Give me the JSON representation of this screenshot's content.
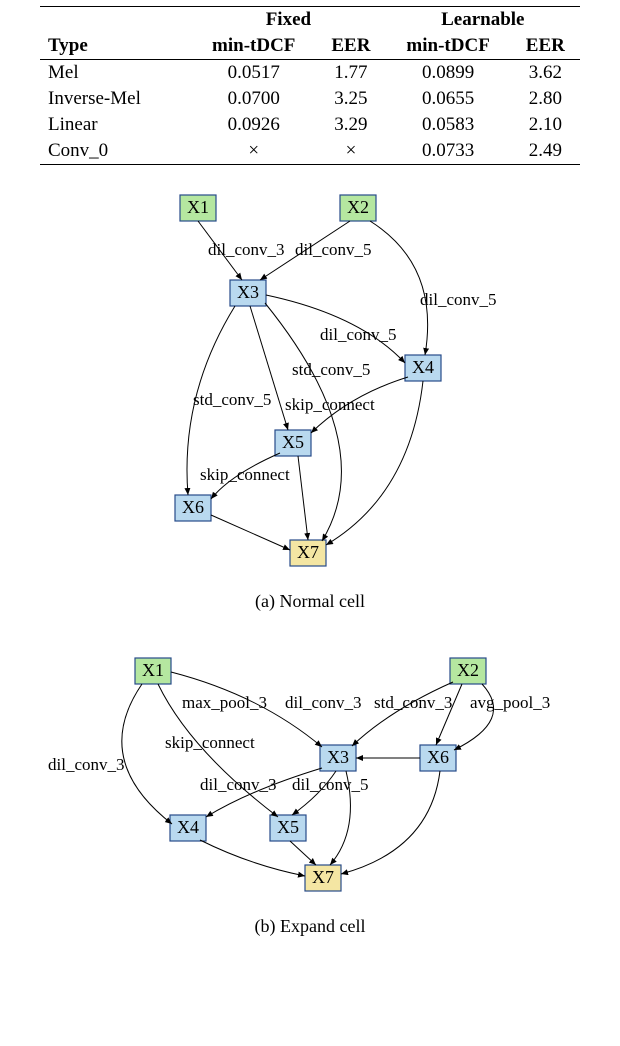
{
  "table": {
    "header_group_fixed": "Fixed",
    "header_group_learnable": "Learnable",
    "col_type": "Type",
    "col_mintdcf": "min-tDCF",
    "col_eer": "EER",
    "rows": [
      {
        "type": "Mel",
        "f_min": "0.0517",
        "f_eer": "1.77",
        "l_min": "0.0899",
        "l_eer": "3.62"
      },
      {
        "type": "Inverse-Mel",
        "f_min": "0.0700",
        "f_eer": "3.25",
        "l_min": "0.0655",
        "l_eer": "2.80"
      },
      {
        "type": "Linear",
        "f_min": "0.0926",
        "f_eer": "3.29",
        "l_min": "0.0583",
        "l_eer": "2.10"
      },
      {
        "type": "Conv_0",
        "f_min": "×",
        "f_eer": "×",
        "l_min": "0.0733",
        "l_eer": "2.49"
      }
    ]
  },
  "normal": {
    "caption": "(a) Normal cell",
    "nodes": {
      "X1": "X1",
      "X2": "X2",
      "X3": "X3",
      "X4": "X4",
      "X5": "X5",
      "X6": "X6",
      "X7": "X7"
    },
    "edges": {
      "e1": "dil_conv_3",
      "e2": "dil_conv_5",
      "e3": "dil_conv_5",
      "e4": "dil_conv_5",
      "e5": "std_conv_5",
      "e6": "std_conv_5",
      "e7": "skip_connect",
      "e8": "skip_connect"
    }
  },
  "expand": {
    "caption": "(b) Expand cell",
    "nodes": {
      "X1": "X1",
      "X2": "X2",
      "X3": "X3",
      "X4": "X4",
      "X5": "X5",
      "X6": "X6",
      "X7": "X7"
    },
    "edges": {
      "e1": "max_pool_3",
      "e2": "dil_conv_3",
      "e3": "std_conv_3",
      "e4": "avg_pool_3",
      "e5": "dil_conv_3",
      "e6": "skip_connect",
      "e7": "dil_conv_3",
      "e8": "dil_conv_5"
    }
  },
  "chart_data": [
    {
      "type": "table",
      "title": "Fixed vs Learnable front-end results",
      "columns": [
        "Type",
        "Fixed min-tDCF",
        "Fixed EER",
        "Learnable min-tDCF",
        "Learnable EER"
      ],
      "rows": [
        [
          "Mel",
          0.0517,
          1.77,
          0.0899,
          3.62
        ],
        [
          "Inverse-Mel",
          0.07,
          3.25,
          0.0655,
          2.8
        ],
        [
          "Linear",
          0.0926,
          3.29,
          0.0583,
          2.1
        ],
        [
          "Conv_0",
          null,
          null,
          0.0733,
          2.49
        ]
      ]
    },
    {
      "type": "diagram",
      "title": "Normal cell",
      "nodes": [
        "X1",
        "X2",
        "X3",
        "X4",
        "X5",
        "X6",
        "X7"
      ],
      "inputs": [
        "X1",
        "X2"
      ],
      "output": "X7",
      "edges": [
        {
          "from": "X1",
          "to": "X3",
          "op": "dil_conv_3"
        },
        {
          "from": "X2",
          "to": "X3",
          "op": "dil_conv_5"
        },
        {
          "from": "X2",
          "to": "X4",
          "op": "dil_conv_5"
        },
        {
          "from": "X3",
          "to": "X4",
          "op": "dil_conv_5"
        },
        {
          "from": "X3",
          "to": "X5",
          "op": "std_conv_5"
        },
        {
          "from": "X4",
          "to": "X5",
          "op": "std_conv_5"
        },
        {
          "from": "X3",
          "to": "X6",
          "op": "skip_connect"
        },
        {
          "from": "X5",
          "to": "X6",
          "op": "skip_connect"
        },
        {
          "from": "X3",
          "to": "X7",
          "op": null
        },
        {
          "from": "X4",
          "to": "X7",
          "op": null
        },
        {
          "from": "X5",
          "to": "X7",
          "op": null
        },
        {
          "from": "X6",
          "to": "X7",
          "op": null
        }
      ]
    },
    {
      "type": "diagram",
      "title": "Expand cell",
      "nodes": [
        "X1",
        "X2",
        "X3",
        "X4",
        "X5",
        "X6",
        "X7"
      ],
      "inputs": [
        "X1",
        "X2"
      ],
      "output": "X7",
      "edges": [
        {
          "from": "X1",
          "to": "X3",
          "op": "max_pool_3"
        },
        {
          "from": "X2",
          "to": "X3",
          "op": "dil_conv_3"
        },
        {
          "from": "X2",
          "to": "X6",
          "op": "std_conv_3"
        },
        {
          "from": "X2",
          "to": "X6",
          "op": "avg_pool_3"
        },
        {
          "from": "X1",
          "to": "X4",
          "op": "dil_conv_3"
        },
        {
          "from": "X1",
          "to": "X5",
          "op": "skip_connect"
        },
        {
          "from": "X3",
          "to": "X4",
          "op": "dil_conv_3"
        },
        {
          "from": "X3",
          "to": "X5",
          "op": "dil_conv_5"
        },
        {
          "from": "X6",
          "to": "X3",
          "op": null
        },
        {
          "from": "X4",
          "to": "X7",
          "op": null
        },
        {
          "from": "X5",
          "to": "X7",
          "op": null
        },
        {
          "from": "X6",
          "to": "X7",
          "op": null
        },
        {
          "from": "X3",
          "to": "X7",
          "op": null
        }
      ]
    }
  ]
}
